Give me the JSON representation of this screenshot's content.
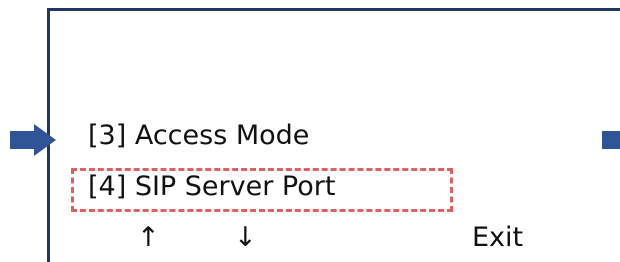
{
  "menu": {
    "items": [
      {
        "label": "[3] Access Mode"
      },
      {
        "label": "[4] SIP Server Port"
      }
    ],
    "highlighted_index": 1
  },
  "nav": {
    "up": "↑",
    "down": "↓",
    "exit": "Exit"
  },
  "colors": {
    "frame": "#1f3864",
    "pointer": "#2f5597",
    "highlight": "#e06060"
  },
  "icons": {
    "pointer_left": "right-arrow-icon",
    "pointer_right": "right-arrow-icon"
  }
}
